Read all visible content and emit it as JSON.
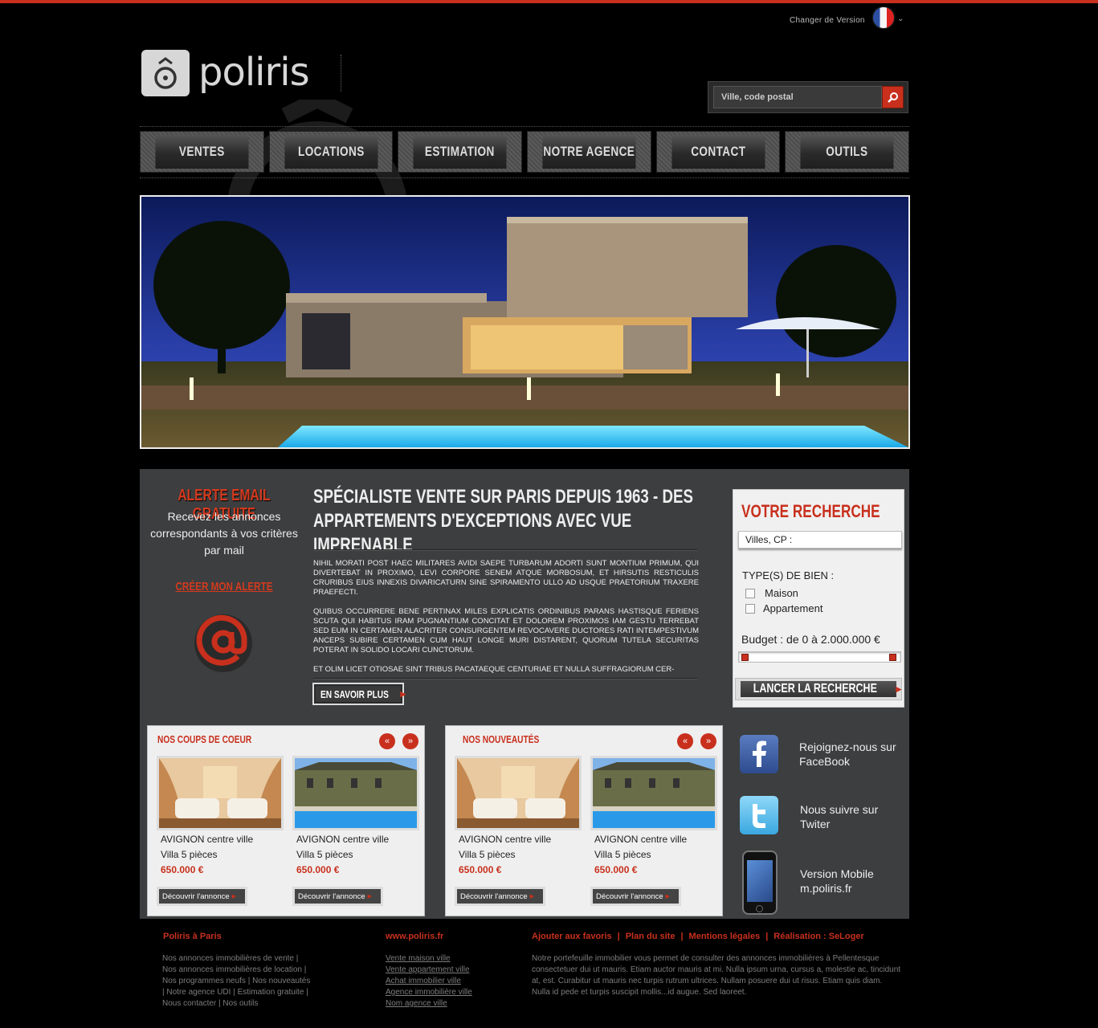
{
  "header": {
    "version_label": "Changer de Version",
    "brand": "poliris",
    "search_placeholder": "Ville, code postal"
  },
  "nav": {
    "items": [
      {
        "label": "Ventes"
      },
      {
        "label": "Locations"
      },
      {
        "label": "Estimation"
      },
      {
        "label": "Notre agence"
      },
      {
        "label": "Contact"
      },
      {
        "label": "Outils"
      }
    ]
  },
  "alert": {
    "title": "ALERTE EMAIL GRATUITE",
    "text": "Recevez les annonces correspondants à vos critères par mail",
    "link": "CRÉER MON ALERTE"
  },
  "intro": {
    "title": "Spécialiste vente sur Paris depuis 1963 - des appartements d'exceptions avec vue imprenable",
    "p1": "NIHIL MORATI POST HAEC MILITARES AVIDI SAEPE TURBARUM ADORTI SUNT MONTIUM PRIMUM, QUI DIVERTEBAT IN PROXIMO, LEVI CORPORE SENEM ATQUE MORBOSUM, ET HIRSUTIS RESTICULIS CRURIBUS EIUS INNEXIS DIVARICATURN SINE SPIRAMENTO ULLO AD USQUE PRAETORIUM TRAXERE PRAEFECTI.",
    "p2": "QUIBUS OCCURRERE BENE PERTINAX MILES EXPLICATIS ORDINIBUS PARANS HASTISQUE FERIENS SCUTA QUI HABITUS IRAM PUGNANTIUM CONCITAT ET DOLOREM PROXIMOS IAM GESTU TERREBAT SED EUM IN CERTAMEN ALACRITER CONSURGENTEM REVOCAVERE DUCTORES RATI INTEMPESTIVUM ANCEPS SUBIRE CERTAMEN CUM HAUT LONGE MURI DISTARENT, QUORUM TUTELA SECURITAS POTERAT IN SOLIDO LOCARI CUNCTORUM.",
    "p3": "ET OLIM LICET OTIOSAE SINT TRIBUS PACATAEQUE CENTURIAE ET NULLA SUFFRAGIORUM CER-",
    "more": "EN SAVOIR PLUS"
  },
  "search_box": {
    "title": "VOTRE RECHERCHE",
    "ville_placeholder": "Villes, CP :",
    "types_label": "TYPE(S) DE BIEN :",
    "types": [
      "Maison",
      "Appartement"
    ],
    "budget_label": "Budget : de 0 à 2.000.000 €",
    "budget_min_fraction": 0,
    "budget_max_fraction": 1,
    "submit": "LANCER LA RECHERCHE"
  },
  "coups_de_coeur": {
    "title": "NOS COUPS DE COEUR",
    "prev": "«",
    "next": "»",
    "cards": [
      {
        "city": "AVIGNON",
        "area": "centre ville",
        "kind": "Villa 5 pièces",
        "price": "650.000 €",
        "cta": "Découvrir l'annonce"
      },
      {
        "city": "AVIGNON",
        "area": "centre ville",
        "kind": "Villa 5 pièces",
        "price": "650.000 €",
        "cta": "Découvrir l'annonce"
      }
    ]
  },
  "nouveautes": {
    "title": "NOS NOUVEAUTÉS",
    "prev": "«",
    "next": "»",
    "cards": [
      {
        "city": "AVIGNON",
        "area": "centre ville",
        "kind": "Villa 5 pièces",
        "price": "650.000 €",
        "cta": "Découvrir l'annonce"
      },
      {
        "city": "AVIGNON",
        "area": "centre ville",
        "kind": "Villa 5 pièces",
        "price": "650.000 €",
        "cta": "Découvrir l'annonce"
      }
    ]
  },
  "social": {
    "facebook_line1": "Rejoignez-nous sur",
    "facebook_line2": "FaceBook",
    "twitter_line1": "Nous suivre sur",
    "twitter_line2": "Twiter",
    "mobile_line1": "Version Mobile",
    "mobile_line2": "m.poliris.fr"
  },
  "footer": {
    "col1_title": "Poliris à Paris",
    "col1_lines": [
      "Nos annonces immobilières de vente |",
      "Nos annonces immobilières de location |",
      "Nos programmes neufs | Nos nouveautés",
      "| Notre agence UDI | Estimation gratuite |",
      "Nous contacter | Nos outils"
    ],
    "col2_title": "www.poliris.fr",
    "col2_links": [
      "Vente maison ville",
      "Vente appartement ville",
      "Achat immobilier ville",
      "Agence immobilière ville",
      "Nom agence ville"
    ],
    "bar_links": [
      "Ajouter aux favoris",
      "Plan du site",
      "Mentions légales",
      "Réalisation : SeLoger"
    ],
    "bar_sep": "|",
    "col3_text": "Notre portefeuille immobilier vous permet de consulter des annonces immobilières à Pellentesque consectetuer dui ut mauris. Etiam auctor mauris at mi. Nulla ipsum urna, cursus a, molestie ac, tincidunt at, est. Curabitur ut mauris nec turpis rutrum ultrices. Nullam posuere dui ut risus. Etiam quis diam. Nulla id pede et turpis suscipit mollis...id augue. Sed laoreet."
  },
  "colors": {
    "accent": "#c8301d",
    "background": "#000000",
    "panel": "#3c3e3f"
  },
  "icons": {
    "search": "search-icon",
    "flag": "france-flag-icon",
    "facebook": "facebook-icon",
    "twitter": "twitter-icon",
    "mobile": "smartphone-icon",
    "email": "at-sign-icon"
  }
}
